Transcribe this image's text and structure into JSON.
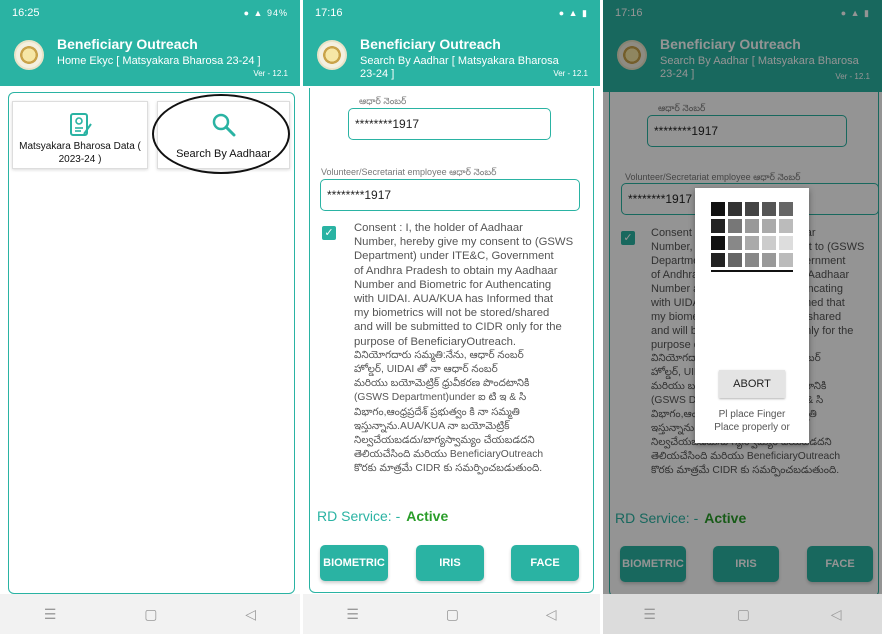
{
  "app": {
    "title": "Beneficiary Outreach",
    "version": "Ver - 12.1",
    "brand_color": "#2ab3a3"
  },
  "screen1": {
    "time": "16:25",
    "battery": "94%",
    "subtitle": "Home Ekyc [ Matsyakara Bharosa  23-24 ]",
    "cards": [
      {
        "label": "Matsyakara Bharosa Data ( 2023-24 )",
        "icon": "document-icon"
      },
      {
        "label": "Search By Aadhaar",
        "icon": "search-icon"
      }
    ]
  },
  "screen2": {
    "time": "17:16",
    "subtitle": "Search By Aadhar [ Matsyakara Bharosa 23-24 ]",
    "aadhaar_label": "ఆధార్ నెంబర్",
    "aadhaar_value": "********1917",
    "volunteer_label": "Volunteer/Secretariat employee ఆధార్ నెంబర్",
    "volunteer_value": "********1917",
    "consent_en_lines": [
      "Consent : I, the holder of Aadhaar",
      "Number, hereby give my consent to (GSWS",
      "Department) under ITE&C, Government",
      "of Andhra Pradesh to obtain my Aadhaar",
      "Number and Biometric for Authencating",
      "with UIDAI. AUA/KUA has Informed that",
      "my biometrics will not be stored/shared",
      "and will be submitted to CIDR only for the",
      "purpose of BeneficiaryOutreach."
    ],
    "consent_te_lines": [
      "వినియోగదారు సమ్మతి:నేను, ఆధార్ నంబర్",
      "హోల్డర్, UIDAI తో నా ఆధార్ నంబర్",
      "మరియు బయోమెట్రిక్ ధ్రువీకరణ పొందటానికి",
      "(GSWS Department)under ఐ టి ఇ & సి",
      "విభాగం,ఆంధ్రప్రదేశ్ ప్రభుత్వం కి నా సమ్మతి",
      "ఇస్తున్నాను.AUA/KUA నా బయోమెట్రిక్",
      "నిల్వచేయబడదు/బాగ్యస్వామ్యం చేయబడదని",
      "తెలియచేసింది మరియు BeneficiaryOutreach",
      "కొరకు మాత్రమే CIDR కు సమర్పించబడుతుంది."
    ],
    "rd_label": "RD Service: -",
    "rd_status": "Active",
    "buttons": [
      "BIOMETRIC",
      "IRIS",
      "FACE"
    ]
  },
  "screen3": {
    "time": "17:16",
    "abort_label": "ABORT",
    "dialog_line1": "Pl place Finger",
    "dialog_line2": "Place properly or"
  }
}
